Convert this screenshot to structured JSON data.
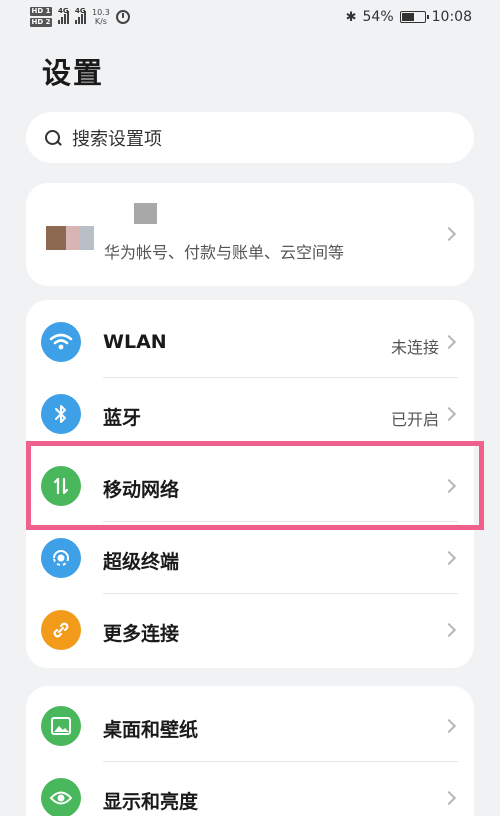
{
  "status_bar": {
    "sim1": "HD 1",
    "sim2": "HD 2",
    "net1": "4G",
    "net2": "4G",
    "speed_value": "10.3",
    "speed_unit": "K/s",
    "bluetooth": "✱",
    "battery": "54%",
    "time": "10:08"
  },
  "page": {
    "title": "设置"
  },
  "search": {
    "placeholder": "搜索设置项"
  },
  "account": {
    "subtitle": "华为帐号、付款与账单、云空间等"
  },
  "connectivity": [
    {
      "label": "WLAN",
      "value": "未连接",
      "icon": "wifi-icon",
      "color": "#3ea0e6"
    },
    {
      "label": "蓝牙",
      "value": "已开启",
      "icon": "bluetooth-icon",
      "color": "#3ea0e6"
    },
    {
      "label": "移动网络",
      "value": "",
      "icon": "mobile-data-icon",
      "color": "#49b85c"
    },
    {
      "label": "超级终端",
      "value": "",
      "icon": "super-device-icon",
      "color": "#3ea0e6"
    },
    {
      "label": "更多连接",
      "value": "",
      "icon": "link-icon",
      "color": "#f29a1a"
    }
  ],
  "display": [
    {
      "label": "桌面和壁纸",
      "icon": "wallpaper-icon",
      "color": "#49b85c"
    },
    {
      "label": "显示和亮度",
      "icon": "eye-icon",
      "color": "#49b85c"
    }
  ],
  "highlight_color": "#f0608c"
}
